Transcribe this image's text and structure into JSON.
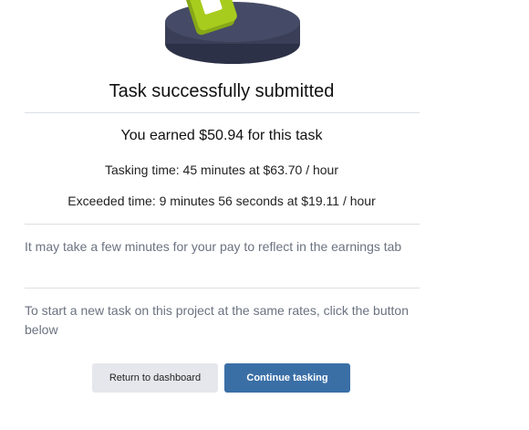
{
  "illustration": {
    "icon": "task-complete-badge-icon",
    "colors": {
      "disk": "#3a3f57",
      "badge": "#a8cc1e"
    }
  },
  "title": "Task successfully submitted",
  "earnings": {
    "earned_text": "You earned $50.94 for this task",
    "tasking_time_text": "Tasking time: 45 minutes at $63.70 / hour",
    "exceeded_time_text": "Exceeded time: 9 minutes 56 seconds at $19.11 / hour"
  },
  "notes": {
    "pay_reflect": "It may take a few minutes for your pay to reflect in the earnings tab",
    "start_new": "To start a new task on this project at the same rates, click the button below"
  },
  "buttons": {
    "return_label": "Return to dashboard",
    "continue_label": "Continue tasking"
  },
  "colors": {
    "primary": "#3a6fa6",
    "secondary": "#e5e7ec",
    "muted_text": "#6b7280"
  }
}
